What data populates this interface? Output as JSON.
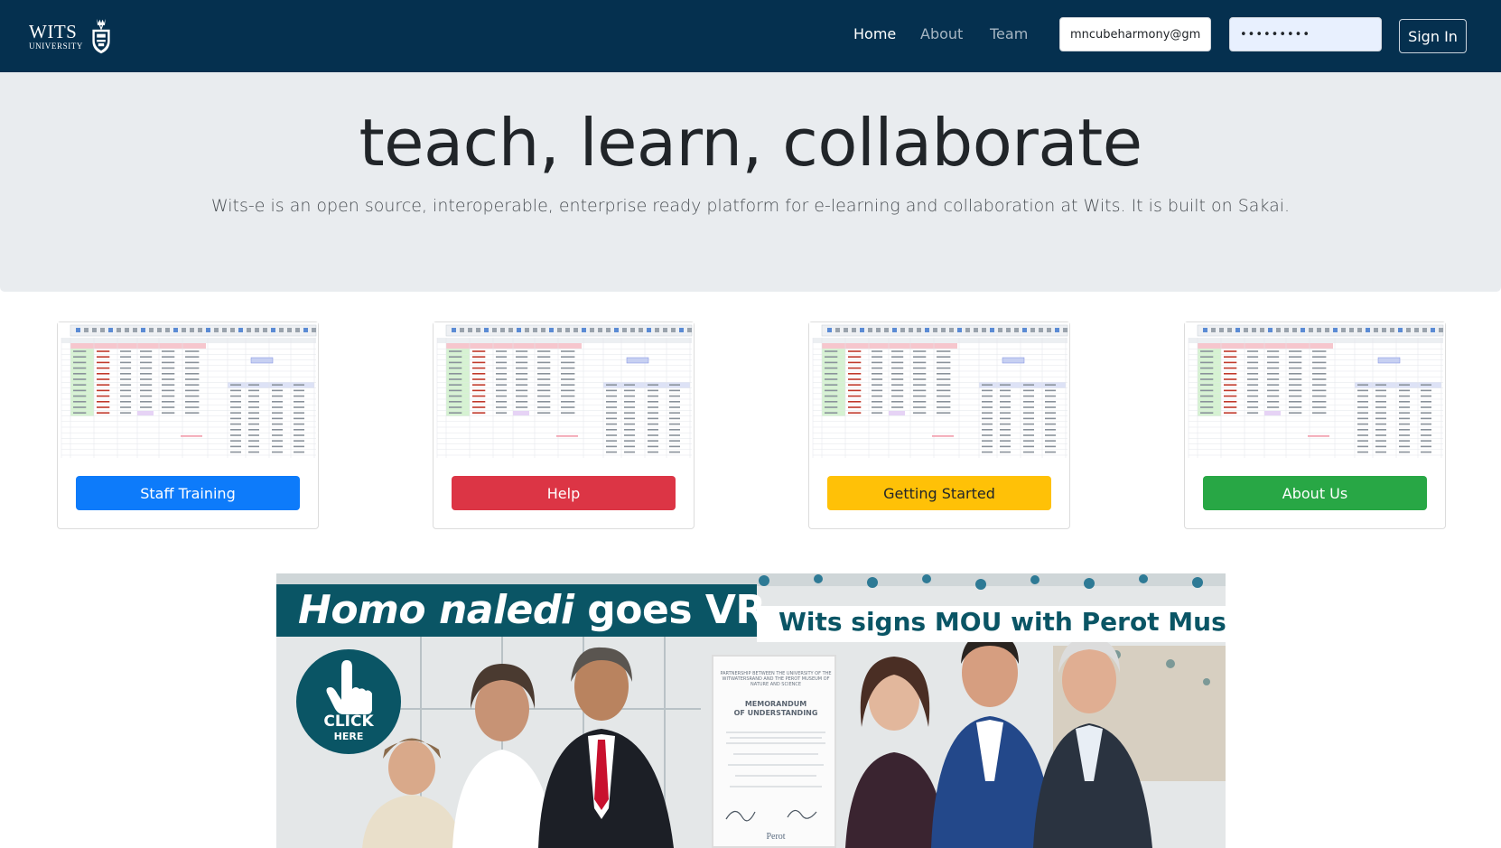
{
  "navbar": {
    "logo_wits": "WITS",
    "logo_university": "UNIVERSITY",
    "links": [
      "Home",
      "About",
      "Team"
    ],
    "active_link": "Home",
    "email_value": "mncubeharmony@gmai",
    "password_value": "•••••••••",
    "signin_label": "Sign In"
  },
  "hero": {
    "title": "teach, learn, collaborate",
    "subtitle": "Wits-e is an open source, interoperable, enterprise ready platform for e-learning and collaboration at Wits. It is built on Sakai."
  },
  "cards": [
    {
      "label": "Staff Training",
      "color": "#0d7bfa"
    },
    {
      "label": "Help",
      "color": "#dc3545"
    },
    {
      "label": "Getting Started",
      "color": "#ffc107"
    },
    {
      "label": "About Us",
      "color": "#28a745"
    }
  ],
  "banner": {
    "headline_italic": "Homo naledi",
    "headline_rest": " goes VR",
    "mou_headline": "Wits signs MOU with Perot Museum",
    "click_label": "CLICK",
    "here_label": "HERE",
    "cert_title_1": "MEMORANDUM",
    "cert_title_2": "OF UNDERSTANDING",
    "cert_partnership": "PARTNERSHIP BETWEEN THE UNIVERSITY OF THE WITWATERSRAND AND THE PEROT MUSEUM OF NATURE AND SCIENCE",
    "cert_perot": "Perot"
  },
  "colors": {
    "navbar_bg": "#05304f",
    "jumbotron_bg": "#e9ecef",
    "banner_teal": "#0a5565"
  }
}
